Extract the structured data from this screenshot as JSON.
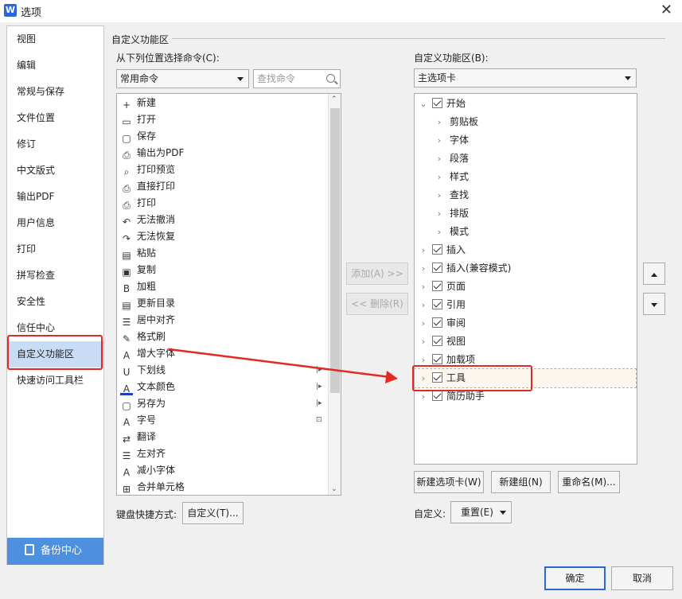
{
  "window": {
    "title": "选项",
    "app_icon_letter": "W"
  },
  "nav": {
    "items": [
      "视图",
      "编辑",
      "常规与保存",
      "文件位置",
      "修订",
      "中文版式",
      "输出PDF",
      "用户信息",
      "打印",
      "拼写检查",
      "安全性",
      "信任中心",
      "自定义功能区",
      "快速访问工具栏"
    ],
    "active_index": 12,
    "backup_label": "备份中心"
  },
  "section": {
    "title": "自定义功能区"
  },
  "left_panel": {
    "label": "从下列位置选择命令(C):",
    "combo_value": "常用命令",
    "search_placeholder": "查找命令",
    "commands": [
      "新建",
      "打开",
      "保存",
      "输出为PDF",
      "打印预览",
      "直接打印",
      "打印",
      "无法撤消",
      "无法恢复",
      "粘贴",
      "复制",
      "加粗",
      "更新目录",
      "居中对齐",
      "格式刷",
      "增大字体",
      "下划线",
      "文本颜色",
      "另存为",
      "字号",
      "翻译",
      "左对齐",
      "减小字体",
      "合并单元格"
    ],
    "keyboard_label": "键盘快捷方式:",
    "keyboard_button": "自定义(T)..."
  },
  "middle": {
    "add_button": "添加(A) >>",
    "remove_button": "<< 删除(R)"
  },
  "right_panel": {
    "label": "自定义功能区(B):",
    "combo_value": "主选项卡",
    "tree": [
      {
        "label": "开始",
        "level": 0,
        "expanded": true,
        "checked": true
      },
      {
        "label": "剪贴板",
        "level": 1
      },
      {
        "label": "字体",
        "level": 1
      },
      {
        "label": "段落",
        "level": 1
      },
      {
        "label": "样式",
        "level": 1
      },
      {
        "label": "查找",
        "level": 1
      },
      {
        "label": "排版",
        "level": 1
      },
      {
        "label": "模式",
        "level": 1
      },
      {
        "label": "插入",
        "level": 0,
        "checked": true
      },
      {
        "label": "插入(兼容模式)",
        "level": 0,
        "checked": true
      },
      {
        "label": "页面",
        "level": 0,
        "checked": true
      },
      {
        "label": "引用",
        "level": 0,
        "checked": true
      },
      {
        "label": "审阅",
        "level": 0,
        "checked": true
      },
      {
        "label": "视图",
        "level": 0,
        "checked": true
      },
      {
        "label": "加载项",
        "level": 0,
        "checked": true
      },
      {
        "label": "工具",
        "level": 0,
        "checked": true,
        "selected": true
      },
      {
        "label": "简历助手",
        "level": 0,
        "checked": true
      }
    ],
    "new_tab_button": "新建选项卡(W)",
    "new_group_button": "新建组(N)",
    "rename_button": "重命名(M)...",
    "customize_label": "自定义:",
    "reset_button": "重置(E)"
  },
  "footer": {
    "ok_button": "确定",
    "cancel_button": "取消"
  },
  "colors": {
    "highlight_red": "#e22a22",
    "accent_blue": "#4d90e0",
    "active_nav": "#c9dcf5"
  }
}
